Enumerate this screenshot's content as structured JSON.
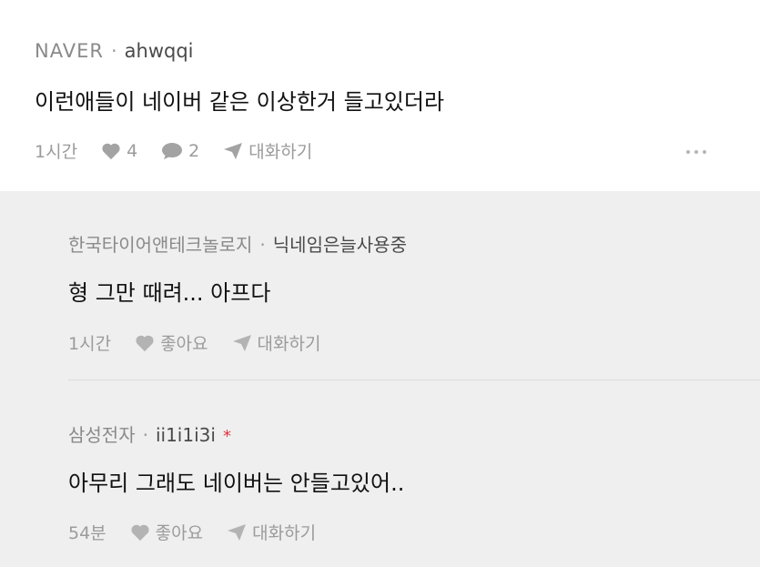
{
  "main_comment": {
    "source": "NAVER",
    "separator": "·",
    "username": "ahwqqi",
    "text": "이런애들이 네이버 같은 이상한거 들고있더라",
    "time": "1시간",
    "like_count": "4",
    "reply_count": "2",
    "talk_label": "대화하기"
  },
  "replies": [
    {
      "source": "한국타이어앤테크놀로지",
      "separator": "·",
      "username": "닉네임은늘사용중",
      "text": "형 그만 때려... 아프다",
      "time": "1시간",
      "like_label": "좋아요",
      "talk_label": "대화하기"
    },
    {
      "source": "삼성전자",
      "separator": "·",
      "username": "ii1i1i3i",
      "mark": "*",
      "text": "아무리 그래도 네이버는 안들고있어..",
      "time": "54분",
      "like_label": "좋아요",
      "talk_label": "대화하기"
    }
  ],
  "colors": {
    "reply_background": "#efefef",
    "meta_gray": "#8a8a8a",
    "mark_red": "#e0323c"
  },
  "icons": [
    "heart-icon",
    "speech-bubble-icon",
    "paper-plane-icon",
    "more-dots-icon"
  ]
}
